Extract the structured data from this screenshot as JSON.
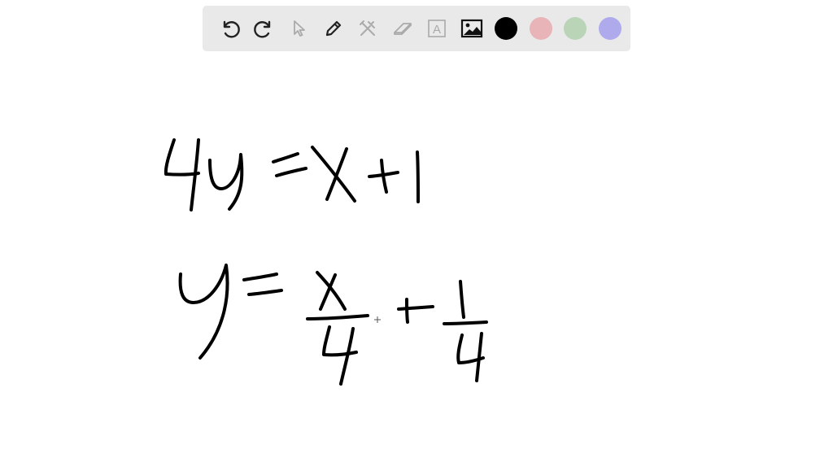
{
  "toolbar": {
    "tools": [
      {
        "id": "undo",
        "icon": "undo-icon",
        "enabled": true
      },
      {
        "id": "redo",
        "icon": "redo-icon",
        "enabled": true
      },
      {
        "id": "select",
        "icon": "pointer-icon",
        "enabled": false
      },
      {
        "id": "pen",
        "icon": "pencil-icon",
        "enabled": true
      },
      {
        "id": "tools",
        "icon": "tools-icon",
        "enabled": false
      },
      {
        "id": "eraser",
        "icon": "eraser-icon",
        "enabled": false
      },
      {
        "id": "text",
        "icon": "text-box-icon",
        "label": "A",
        "enabled": false
      },
      {
        "id": "image",
        "icon": "image-icon",
        "enabled": true
      }
    ],
    "colors": [
      "#000000",
      "#e8b4b8",
      "#b9d4b7",
      "#aeaaec"
    ],
    "selected_color": "#000000"
  },
  "canvas": {
    "ink_color": "#000000",
    "strokes_description": "handwritten"
  }
}
